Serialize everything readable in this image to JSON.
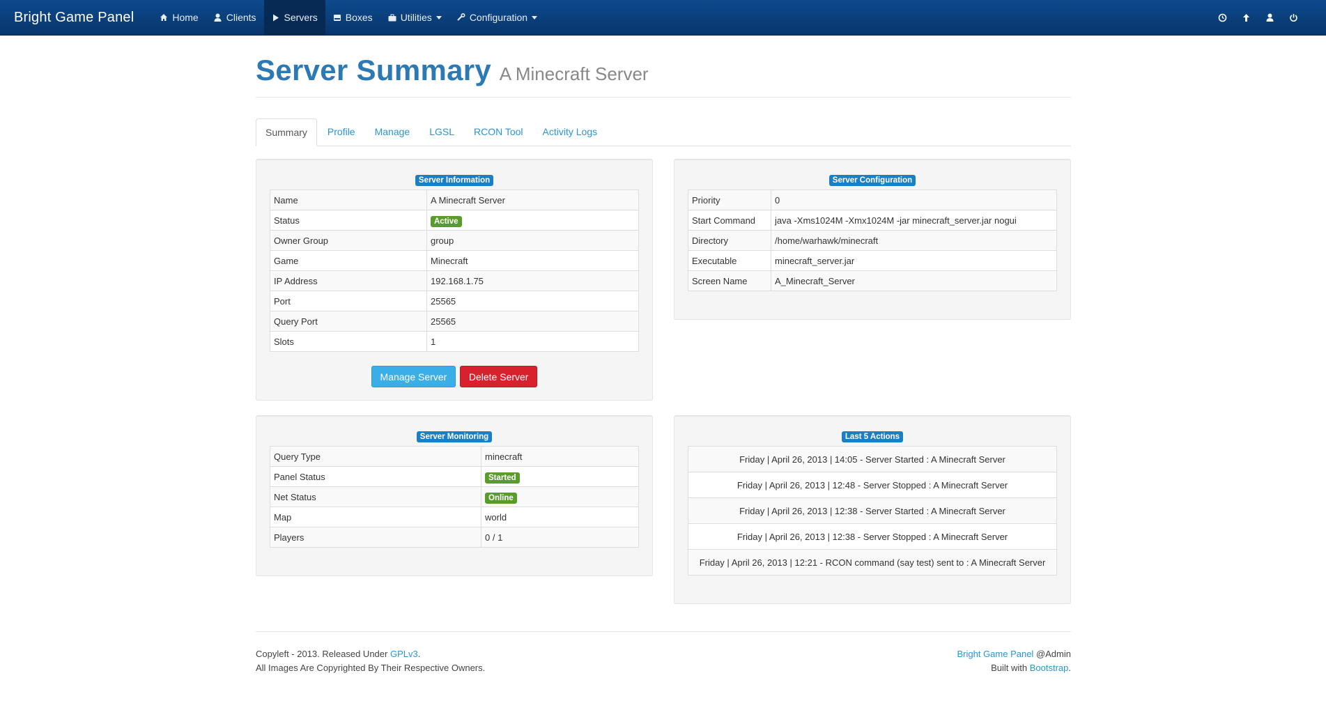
{
  "nav": {
    "brand": "Bright Game Panel",
    "items": [
      {
        "label": "Home",
        "icon": "home-icon"
      },
      {
        "label": "Clients",
        "icon": "user-icon"
      },
      {
        "label": "Servers",
        "icon": "play-icon"
      },
      {
        "label": "Boxes",
        "icon": "hdd-icon"
      },
      {
        "label": "Utilities",
        "icon": "briefcase-icon"
      },
      {
        "label": "Configuration",
        "icon": "wrench-icon"
      }
    ],
    "right_icons": [
      "clock-icon",
      "arrow-up-icon",
      "user-icon",
      "power-icon"
    ]
  },
  "header": {
    "title": "Server Summary",
    "subtitle": "A Minecraft Server"
  },
  "tabs": [
    "Summary",
    "Profile",
    "Manage",
    "LGSL",
    "RCON Tool",
    "Activity Logs"
  ],
  "server_info": {
    "title": "Server Information",
    "rows": [
      {
        "key": "Name",
        "value": "A Minecraft Server"
      },
      {
        "key": "Status",
        "value": "Active"
      },
      {
        "key": "Owner Group",
        "value": "group"
      },
      {
        "key": "Game",
        "value": "Minecraft"
      },
      {
        "key": "IP Address",
        "value": "192.168.1.75"
      },
      {
        "key": "Port",
        "value": "25565"
      },
      {
        "key": "Query Port",
        "value": "25565"
      },
      {
        "key": "Slots",
        "value": "1"
      }
    ],
    "manage_label": "Manage Server",
    "delete_label": "Delete Server"
  },
  "server_config": {
    "title": "Server Configuration",
    "rows": [
      {
        "key": "Priority",
        "value": "0"
      },
      {
        "key": "Start Command",
        "value": "java -Xms1024M -Xmx1024M -jar minecraft_server.jar nogui"
      },
      {
        "key": "Directory",
        "value": "/home/warhawk/minecraft"
      },
      {
        "key": "Executable",
        "value": "minecraft_server.jar"
      },
      {
        "key": "Screen Name",
        "value": "A_Minecraft_Server"
      }
    ]
  },
  "server_monitoring": {
    "title": "Server Monitoring",
    "rows": [
      {
        "key": "Query Type",
        "value": "minecraft"
      },
      {
        "key": "Panel Status",
        "value": "Started"
      },
      {
        "key": "Net Status",
        "value": "Online"
      },
      {
        "key": "Map",
        "value": "world"
      },
      {
        "key": "Players",
        "value": "0 / 1"
      }
    ]
  },
  "last_actions": {
    "title": "Last 5 Actions",
    "items": [
      "Friday | April 26, 2013 | 14:05 - Server Started : A Minecraft Server",
      "Friday | April 26, 2013 | 12:48 - Server Stopped : A Minecraft Server",
      "Friday | April 26, 2013 | 12:38 - Server Started : A Minecraft Server",
      "Friday | April 26, 2013 | 12:38 - Server Stopped : A Minecraft Server",
      "Friday | April 26, 2013 | 12:21 - RCON command (say test) sent to : A Minecraft Server"
    ]
  },
  "footer": {
    "left_line1_prefix": "Copyleft - 2013. Released Under ",
    "left_line1_link": "GPLv3",
    "left_line1_suffix": ".",
    "left_line2": "All Images Are Copyrighted By Their Respective Owners.",
    "right_line1_link": "Bright Game Panel",
    "right_line1_suffix": " @Admin",
    "right_line2_prefix": "Built with ",
    "right_line2_link": "Bootstrap",
    "right_line2_suffix": "."
  },
  "colors": {
    "navbar": "#0b3f7c",
    "link": "#2a95d4",
    "title": "#2c79b3",
    "label_blue": "#1a80c6",
    "badge_green": "#5a9c2b",
    "btn_info": "#3aaee6",
    "btn_danger": "#d7212c"
  }
}
